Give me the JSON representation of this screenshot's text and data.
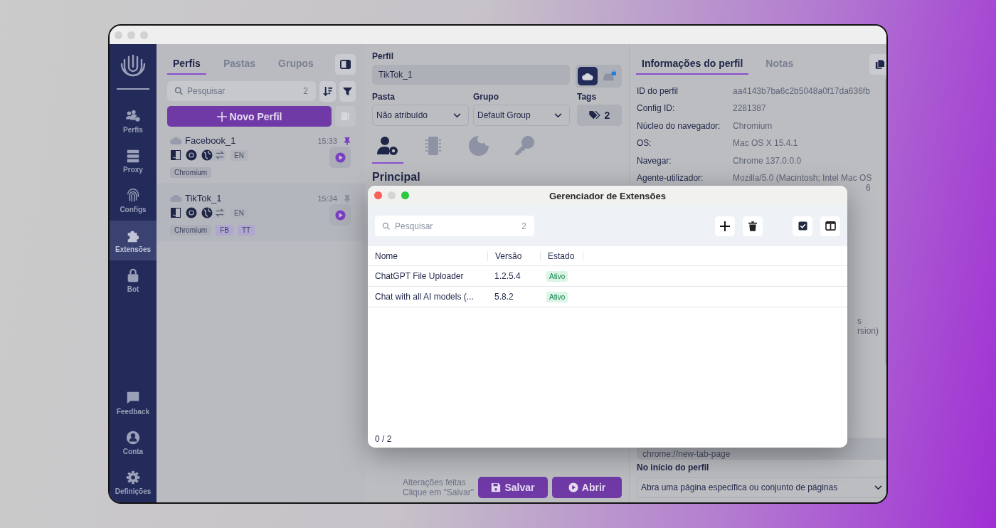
{
  "sidebar": {
    "items": [
      {
        "label": "Perfis",
        "kind": "profiles",
        "selected": false
      },
      {
        "label": "Proxy",
        "kind": "proxy",
        "selected": false
      },
      {
        "label": "Configs",
        "kind": "fingerprint",
        "selected": false
      },
      {
        "label": "Extensões",
        "kind": "extensions",
        "selected": true
      },
      {
        "label": "Bot",
        "kind": "lock",
        "selected": false
      }
    ],
    "bottom_items": [
      {
        "label": "Feedback",
        "kind": "feedback",
        "selected": false
      },
      {
        "label": "Conta",
        "kind": "account",
        "selected": false
      },
      {
        "label": "Definições",
        "kind": "settings",
        "selected": false
      }
    ]
  },
  "profile_list": {
    "tabs": [
      {
        "label": "Perfis",
        "selected": true
      },
      {
        "label": "Pastas",
        "selected": false
      },
      {
        "label": "Grupos",
        "selected": false
      }
    ],
    "search": {
      "placeholder": "Pesquisar",
      "count": "2"
    },
    "new_button": "Novo Perfil",
    "profiles": [
      {
        "name": "Facebook_1",
        "time": "15:33",
        "pinned": true,
        "selected": false,
        "language": "EN",
        "tags": [
          {
            "label": "Chromium",
            "kind": "browser"
          }
        ]
      },
      {
        "name": "TikTok_1",
        "time": "15:34",
        "pinned": false,
        "selected": true,
        "language": "EN",
        "tags": [
          {
            "label": "Chromium",
            "kind": "browser"
          },
          {
            "label": "FB",
            "kind": "custom"
          },
          {
            "label": "TT",
            "kind": "custom"
          }
        ]
      }
    ]
  },
  "editor": {
    "profile_label": "Perfil",
    "profile_name": "TikTok_1",
    "storage": [
      {
        "kind": "cloud",
        "selected": true
      },
      {
        "kind": "local",
        "selected": false
      }
    ],
    "folder": {
      "label": "Pasta",
      "value": "Não atribuído"
    },
    "group": {
      "label": "Grupo",
      "value": "Default Group"
    },
    "tags": {
      "label": "Tags",
      "count": "2"
    },
    "section_tabs": [
      {
        "kind": "user-settings",
        "selected": true
      },
      {
        "kind": "chip",
        "selected": false
      },
      {
        "kind": "cookie",
        "selected": false
      },
      {
        "kind": "key",
        "selected": false
      }
    ],
    "section_title": "Principal",
    "unsaved_hint": [
      "Alterações feitas",
      "Clique em \"Salvar\""
    ],
    "save_button": "Salvar",
    "open_button": "Abrir"
  },
  "info_panel": {
    "tabs": [
      {
        "label": "Informações do perfil",
        "selected": true
      },
      {
        "label": "Notas",
        "selected": false
      }
    ],
    "rows": [
      {
        "label": "ID do perfil",
        "value": "aa4143b7ba6c2b5048a0f17da636fb"
      },
      {
        "label": "Config ID:",
        "value": "2281387"
      },
      {
        "label": "Núcleo do navegador:",
        "value": "Chromium"
      },
      {
        "label": "OS:",
        "value": "Mac OS X 15.4.1"
      },
      {
        "label": "Navegar:",
        "value": "Chrome 137.0.0.0"
      },
      {
        "label": "Agente-utilizador:",
        "value": "Mozilla/5.0 (Macintosh; Intel Mac OS",
        "value_continued": "6"
      }
    ],
    "covered_lines": [
      "s",
      "rsion)"
    ],
    "start_page": "chrome://new-tab-page",
    "on_start": {
      "label": "No início do perfil",
      "value": "Abra uma página específica ou conjunto de páginas"
    }
  },
  "extensions_dialog": {
    "title": "Gerenciador de Extensões",
    "search": {
      "placeholder": "Pesquisar",
      "count": "2"
    },
    "columns": [
      "Nome",
      "Versão",
      "Estado"
    ],
    "rows": [
      {
        "name": "ChatGPT File Uploader",
        "version": "1.2.5.4",
        "status": "Ativo"
      },
      {
        "name": "Chat with all AI models (...",
        "version": "5.8.2",
        "status": "Ativo"
      }
    ],
    "footer": "0 / 2"
  }
}
